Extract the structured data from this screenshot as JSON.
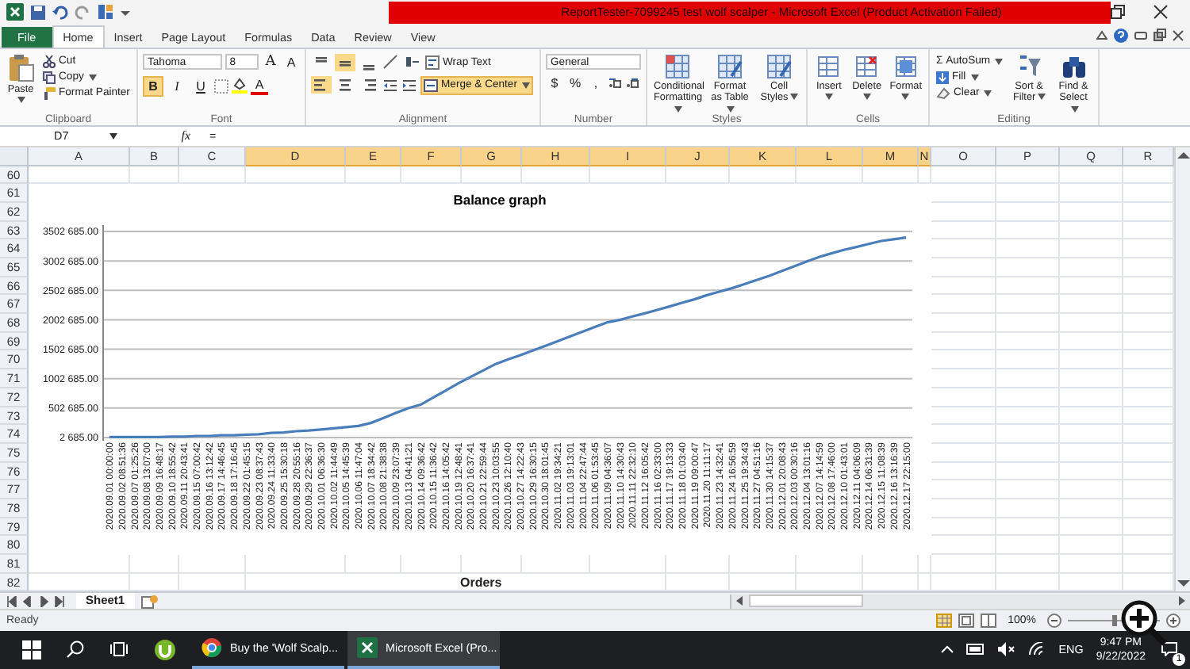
{
  "window": {
    "title": "ReportTester-7099245 test wolf scalper  -  Microsoft Excel (Product Activation Failed)"
  },
  "ribbon_tabs": [
    {
      "label": "File",
      "kind": "file",
      "selected": false
    },
    {
      "label": "Home",
      "kind": "tab",
      "selected": true
    },
    {
      "label": "Insert",
      "kind": "tab",
      "selected": false
    },
    {
      "label": "Page Layout",
      "kind": "tab",
      "selected": false
    },
    {
      "label": "Formulas",
      "kind": "tab",
      "selected": false
    },
    {
      "label": "Data",
      "kind": "tab",
      "selected": false
    },
    {
      "label": "Review",
      "kind": "tab",
      "selected": false
    },
    {
      "label": "View",
      "kind": "tab",
      "selected": false
    }
  ],
  "ribbon": {
    "clipboard": {
      "label": "Clipboard",
      "paste": "Paste",
      "cut": "Cut",
      "copy": "Copy",
      "format_painter": "Format Painter"
    },
    "font": {
      "label": "Font",
      "family": "Tahoma",
      "size": "8",
      "grow": "A",
      "shrink": "A",
      "font_color": "A",
      "style_buttons": [
        {
          "label": "B",
          "kind": "bold",
          "selected": true
        },
        {
          "label": "I",
          "kind": "italic",
          "selected": false
        },
        {
          "label": "U",
          "kind": "underline",
          "selected": false
        }
      ]
    },
    "alignment": {
      "label": "Alignment",
      "wrap_text": "Wrap Text",
      "merge_center": {
        "label": "Merge & Center",
        "selected": true
      },
      "vertical_buttons": [
        {
          "kind": "top",
          "selected": false
        },
        {
          "kind": "middle",
          "selected": true
        },
        {
          "kind": "bottom",
          "selected": false
        }
      ],
      "horizontal_buttons": [
        {
          "kind": "left",
          "selected": true
        },
        {
          "kind": "center",
          "selected": false
        },
        {
          "kind": "right",
          "selected": false
        }
      ]
    },
    "number": {
      "label": "Number",
      "format": "General",
      "currency": "$",
      "percent": "%",
      "comma": ","
    },
    "styles": {
      "label": "Styles",
      "buttons": [
        "Conditional Formatting",
        "Format as Table",
        "Cell Styles"
      ]
    },
    "cells": {
      "label": "Cells",
      "buttons": [
        "Insert",
        "Delete",
        "Format"
      ]
    },
    "editing": {
      "label": "Editing",
      "autosum_sign": "Σ",
      "autosum": "AutoSum",
      "fill": "Fill",
      "clear": "Clear",
      "sort_filter": "Sort & Filter",
      "find_select": "Find & Select"
    }
  },
  "formula_bar": {
    "name_box": "D7",
    "fx": "fx",
    "formula": "="
  },
  "columns": [
    {
      "label": "A",
      "selected": false
    },
    {
      "label": "B",
      "selected": false
    },
    {
      "label": "C",
      "selected": false
    },
    {
      "label": "D",
      "selected": true
    },
    {
      "label": "E",
      "selected": true
    },
    {
      "label": "F",
      "selected": true
    },
    {
      "label": "G",
      "selected": true
    },
    {
      "label": "H",
      "selected": true
    },
    {
      "label": "I",
      "selected": true
    },
    {
      "label": "J",
      "selected": true
    },
    {
      "label": "K",
      "selected": true
    },
    {
      "label": "L",
      "selected": true
    },
    {
      "label": "M",
      "selected": true
    },
    {
      "label": "N",
      "selected": true
    },
    {
      "label": "O",
      "selected": false
    },
    {
      "label": "P",
      "selected": false
    },
    {
      "label": "Q",
      "selected": false
    },
    {
      "label": "R",
      "selected": false
    }
  ],
  "rows": [
    "60",
    "61",
    "62",
    "63",
    "64",
    "65",
    "66",
    "67",
    "68",
    "69",
    "70",
    "71",
    "72",
    "73",
    "74",
    "75",
    "76",
    "77",
    "78",
    "79",
    "80",
    "81",
    "82"
  ],
  "chart": {
    "chart_data": {
      "type": "line",
      "title": "Balance graph",
      "categories": [
        "2020.09.01 00:00:00",
        "2020.09.02 08:51:36",
        "2020.09.07 01:25:26",
        "2020.09.08 13:07:00",
        "2020.09.09 16:48:17",
        "2020.09.10 18:55:42",
        "2020.09.11 20:43:41",
        "2020.09.15 07:00:42",
        "2020.09.16 13:12:42",
        "2020.09.17 14:46:45",
        "2020.09.18 17:16:45",
        "2020.09.22 01:45:15",
        "2020.09.23 08:37:43",
        "2020.09.24 11:33:40",
        "2020.09.25 15:30:18",
        "2020.09.28 20:55:16",
        "2020.09.29 22:36:37",
        "2020.10.01 06:36:30",
        "2020.10.02 11:44:49",
        "2020.10.05 14:45:39",
        "2020.10.06 11:47:04",
        "2020.10.07 18:34:42",
        "2020.10.08 21:38:38",
        "2020.10.09 23:07:39",
        "2020.10.13 04:41:21",
        "2020.10.14 09:36:42",
        "2020.10.15 11:36:42",
        "2020.10.16 14:05:42",
        "2020.10.19 12:48:41",
        "2020.10.20 16:37:41",
        "2020.10.21 22:59:44",
        "2020.10.23 10:03:55",
        "2020.10.26 12:10:40",
        "2020.10.27 14:22:43",
        "2020.10.29 16:30:15",
        "2020.10.30 18:01:45",
        "2020.11.02 19:34:21",
        "2020.11.03 19:13:01",
        "2020.11.04 22:47:44",
        "2020.11.06 01:53:45",
        "2020.11.09 04:36:07",
        "2020.11.10 14:30:43",
        "2020.11.11 22:32:10",
        "2020.11.12 16:05:42",
        "2020.11.16 02:33:00",
        "2020.11.17 19:13:33",
        "2020.11.18 01:03:40",
        "2020.11.19 09:00:47",
        "2020.11.20 11:11:17",
        "2020.11.23 14:32:41",
        "2020.11.24 16:56:59",
        "2020.11.25 19:34:43",
        "2020.11.27 04:51:16",
        "2020.11.30 14:15:37",
        "2020.12.01 20:08:43",
        "2020.12.03 00:30:16",
        "2020.12.04 13:01:16",
        "2020.12.07 14:14:59",
        "2020.12.08 17:46:00",
        "2020.12.10 01:43:01",
        "2020.12.11 04:06:09",
        "2020.12.14 06:31:39",
        "2020.12.15 11:08:39",
        "2020.12.16 13:16:39",
        "2020.12.17 22:15:00"
      ],
      "grid": true,
      "series": [
        {
          "color": "#4a7ebb",
          "values": [
            10000,
            10000,
            10000,
            10000,
            10000,
            20000,
            20000,
            30000,
            30000,
            40000,
            40000,
            50000,
            60000,
            80000,
            90000,
            110000,
            120000,
            140000,
            160000,
            180000,
            200000,
            250000,
            330000,
            420000,
            500000,
            560000,
            680000,
            800000,
            920000,
            1030000,
            1140000,
            1250000,
            1330000,
            1400000,
            1480000,
            1560000,
            1640000,
            1720000,
            1800000,
            1880000,
            1960000,
            2000000,
            2060000,
            2110000,
            2170000,
            2230000,
            2290000,
            2350000,
            2420000,
            2480000,
            2540000,
            2610000,
            2680000,
            2750000,
            2830000,
            2910000,
            2990000,
            3070000,
            3130000,
            3190000,
            3240000,
            3290000,
            3340000,
            3370000,
            3400000
          ]
        }
      ],
      "ylim": [
        2685,
        3502685
      ],
      "yticks": [
        {
          "value": 2685,
          "label": "2 685.00"
        },
        {
          "value": 502685,
          "label": "502 685.00"
        },
        {
          "value": 1002685,
          "label": "1002 685.00"
        },
        {
          "value": 1502685,
          "label": "1502 685.00"
        },
        {
          "value": 2002685,
          "label": "2002 685.00"
        },
        {
          "value": 2502685,
          "label": "2502 685.00"
        },
        {
          "value": 3002685,
          "label": "3002 685.00"
        },
        {
          "value": 3502685,
          "label": "3502 685.00"
        }
      ]
    }
  },
  "orders_title": "Orders",
  "sheet_tabs": [
    {
      "label": "Sheet1",
      "selected": true
    }
  ],
  "status_bar": {
    "status": "Ready",
    "zoom": "100%",
    "level": 0.5
  },
  "taskbar": {
    "apps": [
      {
        "label": "Buy the 'Wolf Scalp...",
        "kind": "browser",
        "selected": false
      },
      {
        "label": "Microsoft Excel (Pro...",
        "kind": "excel",
        "selected": true
      }
    ],
    "language": "ENG",
    "time": "9:47 PM",
    "date": "9/22/2022",
    "notifications": "1"
  }
}
